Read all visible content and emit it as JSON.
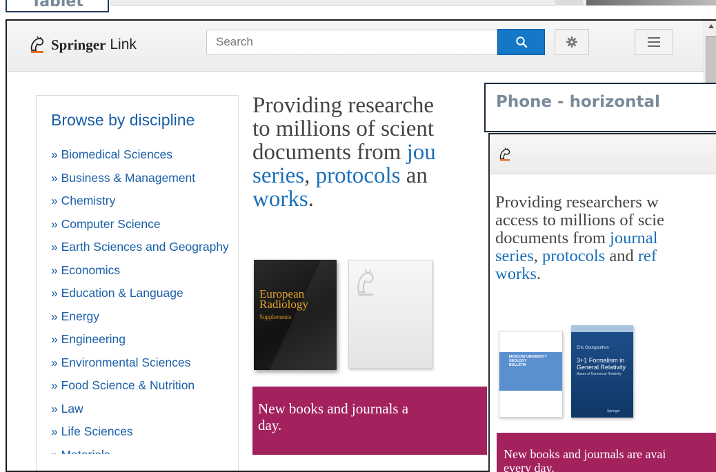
{
  "labels": {
    "tablet": "Tablet",
    "phone_horizontal": "Phone - horizontal"
  },
  "header": {
    "logo_springer": "Springer",
    "logo_link": "Link",
    "search_placeholder": "Search",
    "icons": {
      "search": "search-icon",
      "gear": "gear-icon",
      "menu": "menu-icon"
    }
  },
  "sidebar": {
    "title": "Browse by discipline",
    "items": [
      "» Biomedical Sciences",
      "» Business & Management",
      "» Chemistry",
      "» Computer Science",
      "» Earth Sciences and Geography",
      "» Economics",
      "» Education & Language",
      "» Energy",
      "» Engineering",
      "» Environmental Sciences",
      "» Food Science & Nutrition",
      "» Law",
      "» Life Sciences",
      "» Materials"
    ]
  },
  "main": {
    "tagline": {
      "line1": "Providing researche",
      "line2": "to millions of scient",
      "line3_prefix": "documents from ",
      "line3_link": "jou",
      "line4_link1": "series",
      "line4_sep": ", ",
      "line4_link2": "protocols",
      "line4_suffix": " an",
      "line5_link": "works",
      "line5_suffix": "."
    },
    "covers": {
      "european_radiology_title1": "European",
      "european_radiology_title2": "Radiology",
      "european_radiology_sub": "Supplements"
    },
    "promo": {
      "line1": "New books and journals a",
      "line2": "day."
    }
  },
  "phone": {
    "tagline": {
      "line1": "Providing researchers w",
      "line2": "access to millions of scie",
      "line3_prefix": "documents from ",
      "line3_link": "journal",
      "line4_link1": "series",
      "line4_sep": ", ",
      "line4_link2": "protocols",
      "line4_mid": " and ",
      "line4_link3": "ref",
      "line5_link": "works",
      "line5_suffix": "."
    },
    "covers": {
      "moscow_title1": "MOSCOW UNIVERSITY",
      "moscow_title2": "GEOLOGY",
      "moscow_title3": "BULLETIN",
      "formalism_author": "Eric Gourgoulhon",
      "formalism_title1": "3+1 Formalism in",
      "formalism_title2": "General Relativity",
      "formalism_sub": "Bases of Numerical Relativity",
      "formalism_publisher": "Springer"
    },
    "promo": {
      "line1": "New books and journals are avai",
      "line2": "every day."
    }
  },
  "colors": {
    "link_blue": "#1a5fa8",
    "search_blue": "#1577c8",
    "promo_magenta": "#a3225e"
  }
}
